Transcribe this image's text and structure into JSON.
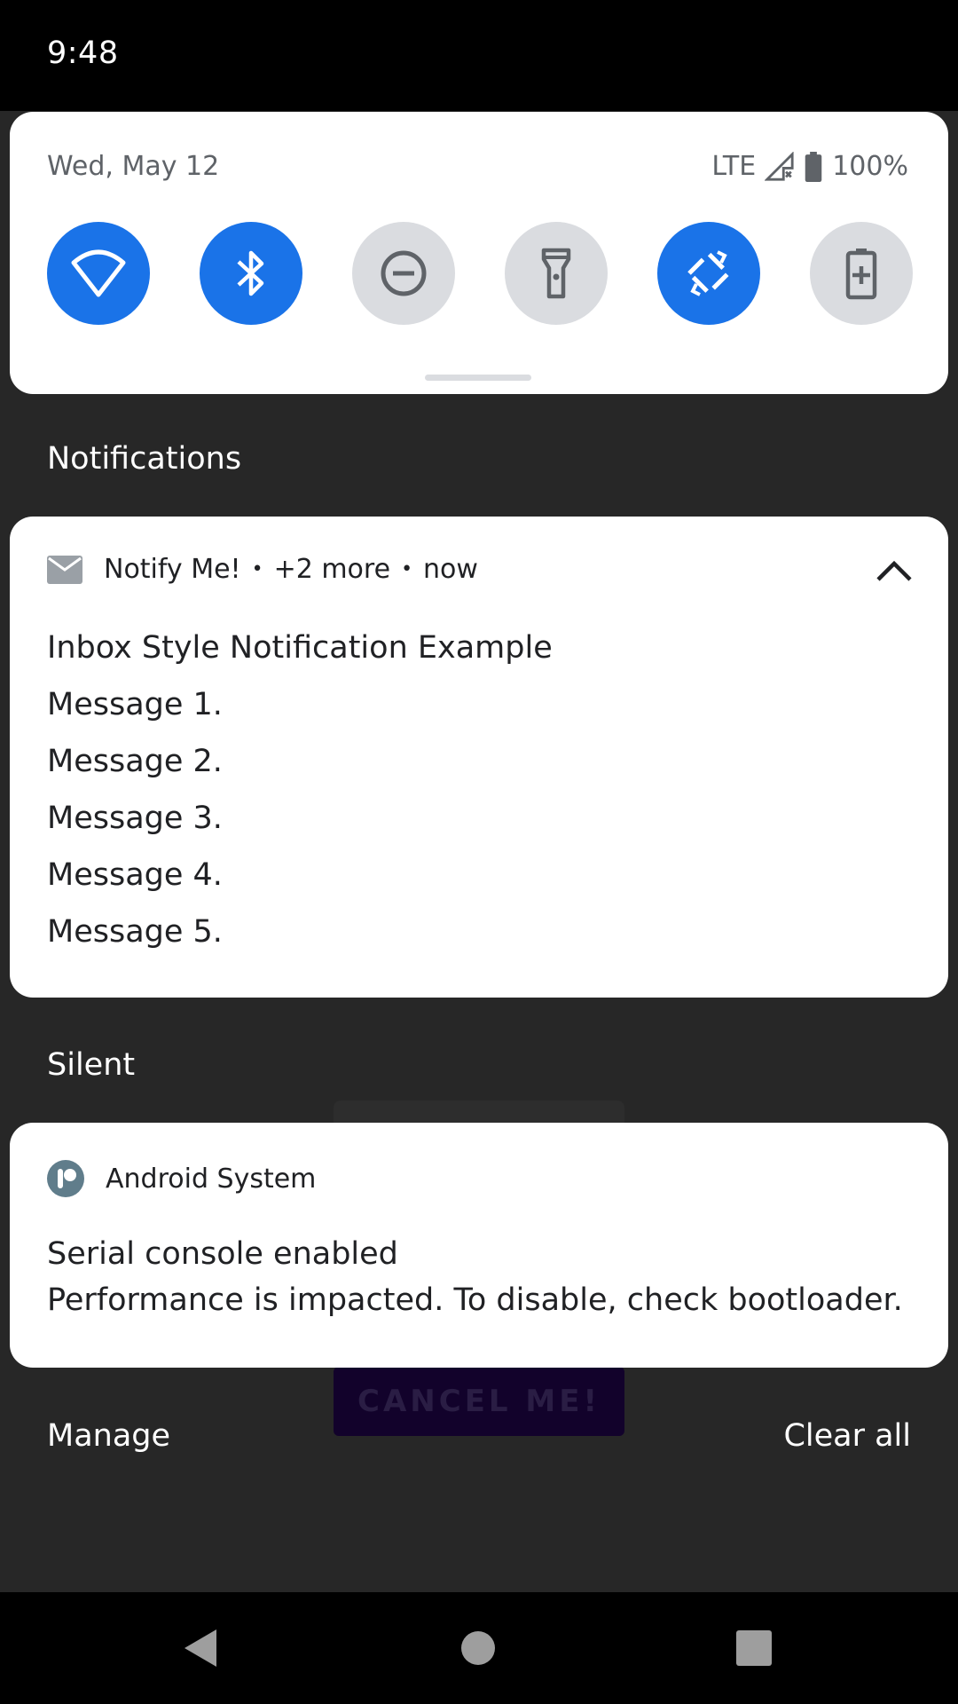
{
  "status_bar": {
    "time": "9:48"
  },
  "quick_settings": {
    "date": "Wed, May 12",
    "network": "LTE",
    "battery": "100%",
    "tiles": [
      {
        "name": "wifi",
        "state": "on",
        "icon": "wifi-icon"
      },
      {
        "name": "bluetooth",
        "state": "on",
        "icon": "bluetooth-icon"
      },
      {
        "name": "do-not-disturb",
        "state": "off",
        "icon": "do-not-disturb-icon"
      },
      {
        "name": "flashlight",
        "state": "off",
        "icon": "flashlight-icon"
      },
      {
        "name": "auto-rotate",
        "state": "on",
        "icon": "auto-rotate-icon"
      },
      {
        "name": "battery-saver",
        "state": "off",
        "icon": "battery-saver-icon"
      }
    ]
  },
  "notifications_header": "Notifications",
  "inbox_notification": {
    "app": "Notify Me!",
    "more": "+2 more",
    "time": "now",
    "title": "Inbox Style Notification Example",
    "messages": [
      "Message 1.",
      "Message 2.",
      "Message 3.",
      "Message 4.",
      "Message 5."
    ]
  },
  "silent_header": "Silent",
  "system_notification": {
    "app": "Android System",
    "title": "Serial console enabled",
    "text": "Performance is impacted. To disable, check bootloader."
  },
  "background_button": "CANCEL ME!",
  "footer": {
    "manage": "Manage",
    "clear_all": "Clear all"
  },
  "colors": {
    "accent": "#1a73e8",
    "tile_off": "#dadce0",
    "shade_bg": "#272727"
  }
}
